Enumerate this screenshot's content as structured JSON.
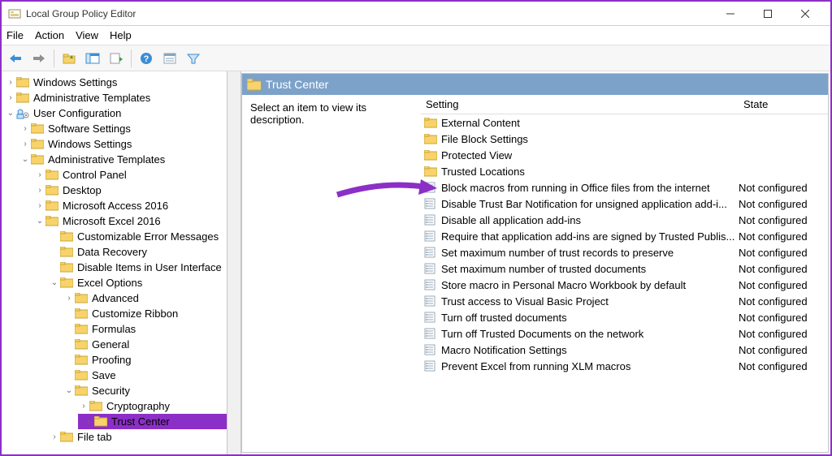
{
  "window": {
    "title": "Local Group Policy Editor"
  },
  "menu": {
    "file": "File",
    "action": "Action",
    "view": "View",
    "help": "Help"
  },
  "tree": {
    "root": [
      {
        "label": "Windows Settings"
      },
      {
        "label": "Administrative Templates"
      }
    ],
    "userConfig": "User Configuration",
    "uc_children": [
      "Software Settings",
      "Windows Settings"
    ],
    "adminTemplates": "Administrative Templates",
    "at_children": [
      "Control Panel",
      "Desktop",
      "Microsoft Access 2016"
    ],
    "excel": "Microsoft Excel 2016",
    "excel_children": [
      "Customizable Error Messages",
      "Data Recovery",
      "Disable Items in User Interface"
    ],
    "excelOptions": "Excel Options",
    "eo_children": [
      "Advanced",
      "Customize Ribbon",
      "Formulas",
      "General",
      "Proofing",
      "Save"
    ],
    "security": "Security",
    "sec_children": [
      "Cryptography"
    ],
    "trustCenter": "Trust Center",
    "fileTab": "File tab"
  },
  "panel": {
    "title": "Trust Center",
    "hint": "Select an item to view its description.",
    "col_setting": "Setting",
    "col_state": "State",
    "folders": [
      "External Content",
      "File Block Settings",
      "Protected View",
      "Trusted Locations"
    ],
    "items": [
      {
        "name": "Block macros from running in Office files from the internet",
        "state": "Not configured"
      },
      {
        "name": "Disable Trust Bar Notification for unsigned application add-i...",
        "state": "Not configured"
      },
      {
        "name": "Disable all application add-ins",
        "state": "Not configured"
      },
      {
        "name": "Require that application add-ins are signed by Trusted Publis...",
        "state": "Not configured"
      },
      {
        "name": "Set maximum number of trust records to preserve",
        "state": "Not configured"
      },
      {
        "name": "Set maximum number of trusted documents",
        "state": "Not configured"
      },
      {
        "name": "Store macro in Personal Macro Workbook by default",
        "state": "Not configured"
      },
      {
        "name": "Trust access to Visual Basic Project",
        "state": "Not configured"
      },
      {
        "name": "Turn off trusted documents",
        "state": "Not configured"
      },
      {
        "name": "Turn off Trusted Documents on the network",
        "state": "Not configured"
      },
      {
        "name": "Macro Notification Settings",
        "state": "Not configured"
      },
      {
        "name": "Prevent Excel from running XLM macros",
        "state": "Not configured"
      }
    ]
  }
}
